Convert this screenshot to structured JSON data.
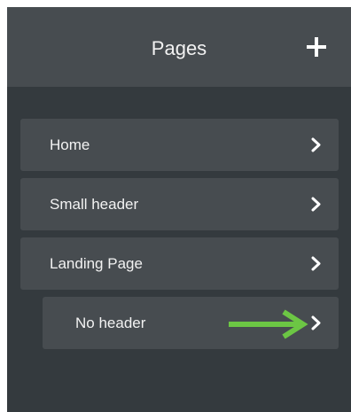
{
  "header": {
    "title": "Pages",
    "add_icon": "plus-icon"
  },
  "pages": [
    {
      "label": "Home",
      "icon": "chevron-right-icon"
    },
    {
      "label": "Small header",
      "icon": "chevron-right-icon"
    },
    {
      "label": "Landing Page",
      "icon": "chevron-right-icon"
    },
    {
      "label": "No header",
      "icon": "chevron-right-icon",
      "nested": true
    }
  ],
  "annotation": {
    "icon": "arrow-right-icon",
    "color": "#6cc644"
  },
  "colors": {
    "panel": "#343a3e",
    "header": "#474c50",
    "item": "#474c50",
    "text": "#f2f2f2"
  }
}
